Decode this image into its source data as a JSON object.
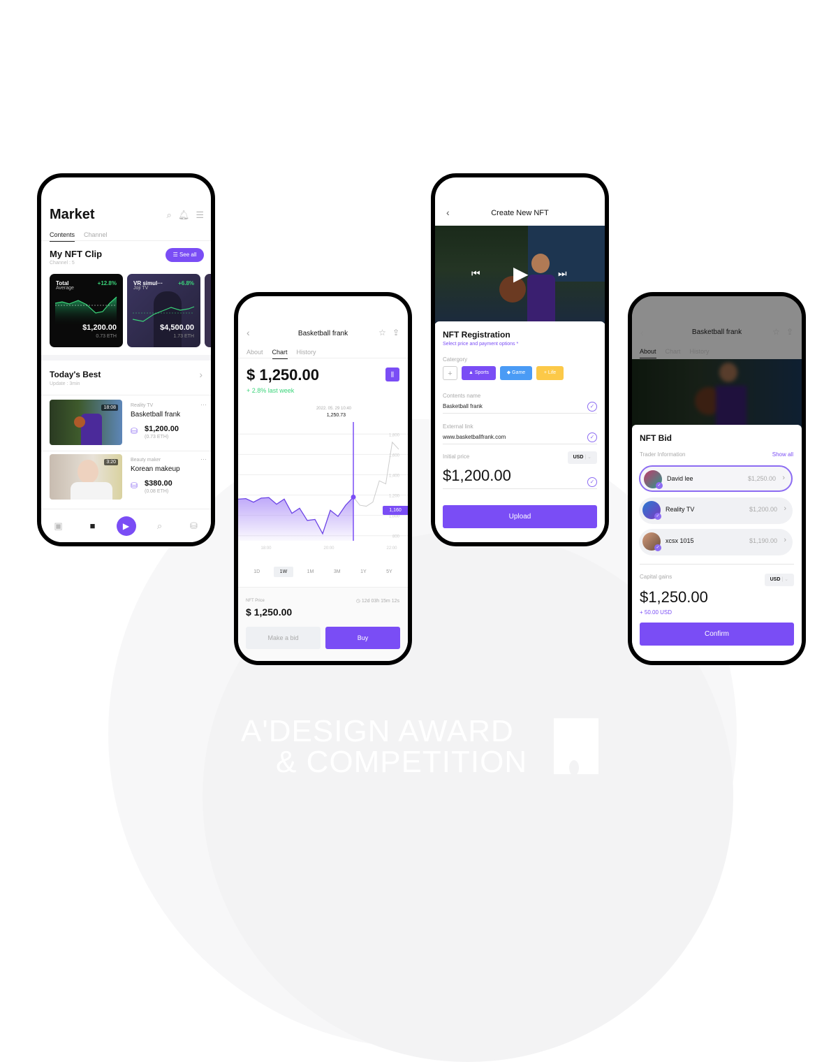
{
  "colors": {
    "accent": "#7a4df5",
    "positive": "#3bd47a",
    "game_chip": "#4a9bf5",
    "life_chip": "#fcc948"
  },
  "watermark": {
    "line1": "A'DESIGN AWARD",
    "line2": "& COMPETITION"
  },
  "market": {
    "title": "Market",
    "icons": [
      "search-icon",
      "bell-icon",
      "menu-icon"
    ],
    "tabs": [
      {
        "label": "Contents",
        "active": true
      },
      {
        "label": "Channel",
        "active": false
      }
    ],
    "my_nft_clip": {
      "title": "My NFT Clip",
      "subtitle": "Channel : 5",
      "see_all": "See all",
      "cards": [
        {
          "title": "Total",
          "subtitle": "Average",
          "change": "+12.8%",
          "price": "$1,200.00",
          "eth": "0.73 ETH"
        },
        {
          "title": "VR simul···",
          "subtitle": "Joji TV",
          "change": "+6.8%",
          "price": "$4,500.00",
          "eth": "1.73 ETH"
        }
      ]
    },
    "todays_best": {
      "title": "Today's Best",
      "subtitle": "Update : 3min",
      "items": [
        {
          "category": "Reality TV",
          "title": "Basketball frank",
          "price": "$1,200.00",
          "eth": "(0.73 ETH)",
          "duration": "18:08"
        },
        {
          "category": "Beauty maker",
          "title": "Korean makeup",
          "price": "$380.00",
          "eth": "(0.08 ETH)",
          "duration": "3:20"
        }
      ]
    },
    "nav": [
      "video-icon",
      "cube-icon",
      "play-plus-icon",
      "search-play-icon",
      "coins-icon"
    ]
  },
  "chart_screen": {
    "title": "Basketball frank",
    "tabs": [
      {
        "label": "About",
        "active": false
      },
      {
        "label": "Chart",
        "active": true
      },
      {
        "label": "History",
        "active": false
      }
    ],
    "price": "$ 1,250.00",
    "change": "+ 2.8% last week",
    "tooltip_date": "2022. 05. 29 10:40",
    "tooltip_value": "1,250.73",
    "current_tag": "1,160",
    "ranges": [
      {
        "label": "1D",
        "active": false
      },
      {
        "label": "1W",
        "active": true
      },
      {
        "label": "1M",
        "active": false
      },
      {
        "label": "3M",
        "active": false
      },
      {
        "label": "1Y",
        "active": false
      },
      {
        "label": "5Y",
        "active": false
      }
    ],
    "nft_price_label": "NFT Price",
    "nft_price": "$ 1,250.00",
    "timer": "12d 03h 15m 12s",
    "make_bid": "Make a bid",
    "buy": "Buy"
  },
  "chart_data": {
    "type": "line",
    "title": "",
    "xlabel": "",
    "ylabel": "",
    "x_ticks": [
      "18:00",
      "20:00",
      "22:00"
    ],
    "y_ticks": [
      800,
      1000,
      1200,
      1400,
      1600,
      1800
    ],
    "ylim": [
      750,
      1850
    ],
    "series": [
      {
        "name": "history",
        "values": [
          1160,
          1165,
          1130,
          1170,
          1175,
          1110,
          1160,
          1020,
          1070,
          950,
          960,
          820,
          1050,
          990,
          1100,
          1180
        ]
      },
      {
        "name": "projection",
        "values": [
          1180,
          1100,
          1090,
          1130,
          1340,
          1310,
          1720,
          1650
        ]
      }
    ],
    "highlight": {
      "label": "2022. 05. 29 10:40",
      "value": 1250.73
    }
  },
  "create_nft": {
    "title": "Create New NFT",
    "registration_title": "NFT Registration",
    "registration_sub": "Select price and payment options *",
    "category_label": "Catergory",
    "chips": [
      {
        "label": "Sports",
        "icon": "▲"
      },
      {
        "label": "Game",
        "icon": "◆"
      },
      {
        "label": "Life",
        "icon": "+"
      }
    ],
    "contents_name_label": "Contents name",
    "contents_name": "Basketball frank",
    "external_link_label": "External link",
    "external_link": "www.basketballfrank.com",
    "initial_price_label": "Initial price",
    "currency": "USD",
    "initial_price": "$1,200.00",
    "upload": "Upload"
  },
  "nft_bid": {
    "title": "Basketball frank",
    "tabs": [
      {
        "label": "About",
        "active": true
      },
      {
        "label": "Chart",
        "active": false
      },
      {
        "label": "History",
        "active": false
      }
    ],
    "bid_title": "NFT Bid",
    "trader_info": "Trader Information",
    "show_all": "Show all",
    "bids": [
      {
        "name": "David lee",
        "price": "$1,250.00",
        "active": true
      },
      {
        "name": "Reality TV",
        "price": "$1,200.00",
        "active": false
      },
      {
        "name": "xcsx 1015",
        "price": "$1,190.00",
        "active": false
      }
    ],
    "capital_gains_label": "Capital gains",
    "currency": "USD",
    "capital_gains": "$1,250.00",
    "gain_delta": "+ 50.00 USD",
    "confirm": "Confirm"
  }
}
